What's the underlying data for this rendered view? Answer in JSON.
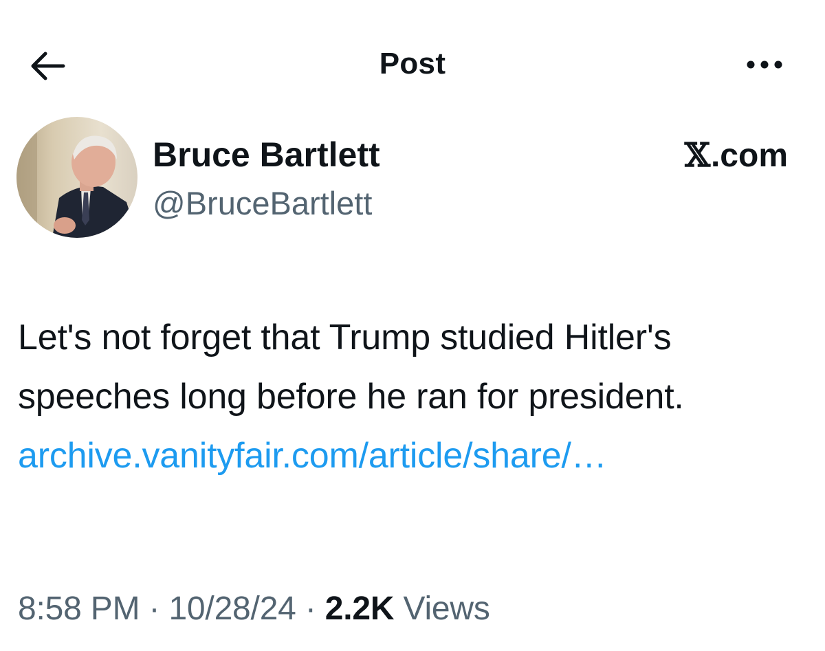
{
  "header": {
    "title": "Post",
    "back_icon": "arrow-left-icon",
    "more_icon": "ellipsis-icon"
  },
  "author": {
    "name": "Bruce Bartlett",
    "handle": "@BruceBartlett",
    "avatar_icon": "avatar"
  },
  "source": {
    "label": ".com"
  },
  "post": {
    "text": "Let's not forget that Trump studied Hitler's speeches long before he ran for president. ",
    "link_text": "archive.vanityfair.com/article/share/…"
  },
  "meta": {
    "time": "8:58 PM",
    "separator": "·",
    "date": "10/28/24",
    "views_count": "2.2K",
    "views_label": "Views"
  },
  "colors": {
    "text": "#0f1419",
    "secondary": "#536471",
    "link": "#1d9bf0"
  }
}
